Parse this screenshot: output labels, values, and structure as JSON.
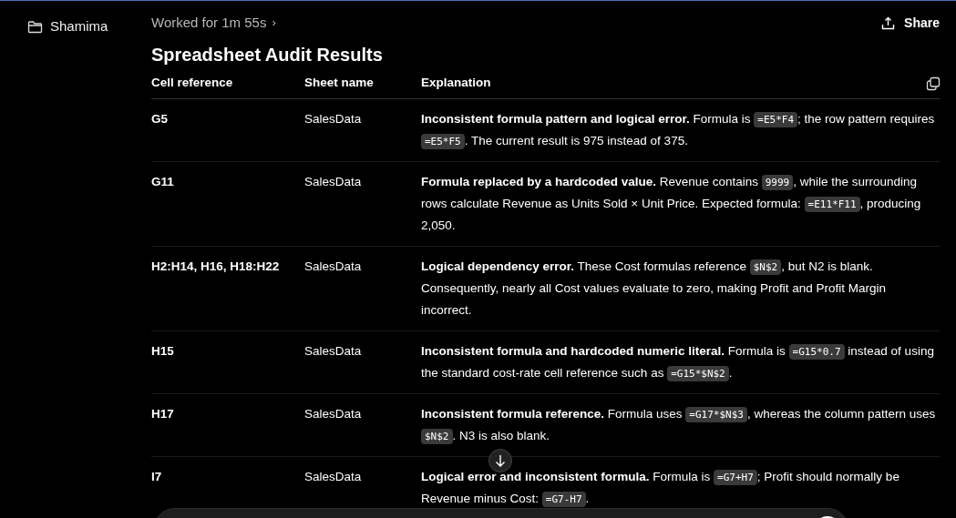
{
  "sidebar": {
    "folder": "Shamima"
  },
  "header": {
    "status": "Worked for 1m 55s",
    "chevron": "›",
    "share": "Share"
  },
  "title": "Spreadsheet Audit Results",
  "table": {
    "columns": [
      "Cell reference",
      "Sheet name",
      "Explanation"
    ],
    "rows": [
      {
        "cell": "G5",
        "sheet": "SalesData",
        "explanation": [
          {
            "kind": "bold",
            "text": "Inconsistent formula pattern and logical error."
          },
          {
            "kind": "text",
            "text": " Formula is "
          },
          {
            "kind": "code",
            "text": "=E5*F4"
          },
          {
            "kind": "text",
            "text": "; the row pattern requires "
          },
          {
            "kind": "code",
            "text": "=E5*F5"
          },
          {
            "kind": "text",
            "text": ". The current result is 975 instead of 375."
          }
        ]
      },
      {
        "cell": "G11",
        "sheet": "SalesData",
        "explanation": [
          {
            "kind": "bold",
            "text": "Formula replaced by a hardcoded value."
          },
          {
            "kind": "text",
            "text": " Revenue contains "
          },
          {
            "kind": "code",
            "text": "9999"
          },
          {
            "kind": "text",
            "text": ", while the surrounding rows calculate Revenue as Units Sold × Unit Price. Expected formula: "
          },
          {
            "kind": "code",
            "text": "=E11*F11"
          },
          {
            "kind": "text",
            "text": ", producing 2,050."
          }
        ]
      },
      {
        "cell": "H2:H14, H16, H18:H22",
        "sheet": "SalesData",
        "explanation": [
          {
            "kind": "bold",
            "text": "Logical dependency error."
          },
          {
            "kind": "text",
            "text": " These Cost formulas reference "
          },
          {
            "kind": "code",
            "text": "$N$2"
          },
          {
            "kind": "text",
            "text": ", but N2 is blank. Consequently, nearly all Cost values evaluate to zero, making Profit and Profit Margin incorrect."
          }
        ]
      },
      {
        "cell": "H15",
        "sheet": "SalesData",
        "explanation": [
          {
            "kind": "bold",
            "text": "Inconsistent formula and hardcoded numeric literal."
          },
          {
            "kind": "text",
            "text": " Formula is "
          },
          {
            "kind": "code",
            "text": "=G15*0.7"
          },
          {
            "kind": "text",
            "text": " instead of using the standard cost-rate cell reference such as "
          },
          {
            "kind": "code",
            "text": "=G15*$N$2"
          },
          {
            "kind": "text",
            "text": "."
          }
        ]
      },
      {
        "cell": "H17",
        "sheet": "SalesData",
        "explanation": [
          {
            "kind": "bold",
            "text": "Inconsistent formula reference."
          },
          {
            "kind": "text",
            "text": " Formula uses "
          },
          {
            "kind": "code",
            "text": "=G17*$N$3"
          },
          {
            "kind": "text",
            "text": ", whereas the column pattern uses "
          },
          {
            "kind": "code",
            "text": "$N$2"
          },
          {
            "kind": "text",
            "text": ". N3 is also blank."
          }
        ]
      },
      {
        "cell": "I7",
        "sheet": "SalesData",
        "explanation": [
          {
            "kind": "bold",
            "text": "Logical error and inconsistent formula."
          },
          {
            "kind": "text",
            "text": " Formula is "
          },
          {
            "kind": "code",
            "text": "=G7+H7"
          },
          {
            "kind": "text",
            "text": "; Profit should normally be Revenue minus Cost: "
          },
          {
            "kind": "code",
            "text": "=G7-H7"
          },
          {
            "kind": "text",
            "text": "."
          }
        ]
      }
    ]
  }
}
